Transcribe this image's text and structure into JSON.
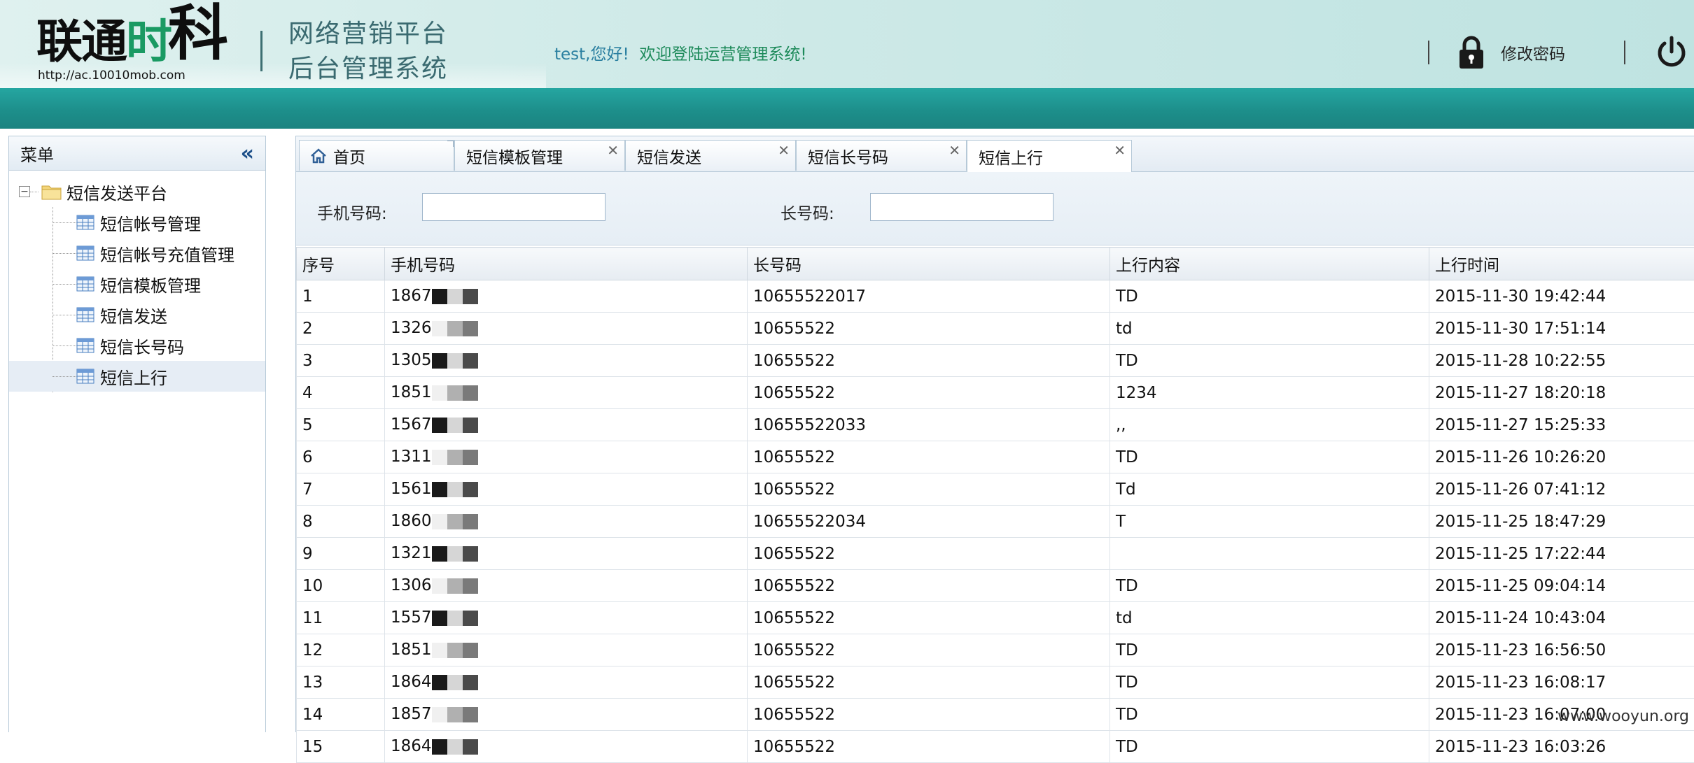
{
  "header": {
    "logo_text_a": "联通",
    "logo_text_b": "时",
    "logo_text_c": "科",
    "logo_url": "http://ac.10010mob.com",
    "platform_line1": "网络营销平台",
    "platform_line2": "后台管理系统",
    "greeting": "test,您好!",
    "welcome": "欢迎登陆运营管理系统!",
    "change_password": "修改密码",
    "colors": {
      "band": "#1d8f8b",
      "welcome_text": "#1d8a5a"
    }
  },
  "sidebar": {
    "title": "菜单",
    "collapse_icon": "double-chevron-left-icon",
    "root": {
      "toggle": "−",
      "label": "短信发送平台",
      "icon": "folder-icon"
    },
    "items": [
      {
        "label": "短信帐号管理",
        "icon": "table-icon",
        "selected": false
      },
      {
        "label": "短信帐号充值管理",
        "icon": "table-icon",
        "selected": false
      },
      {
        "label": "短信模板管理",
        "icon": "table-icon",
        "selected": false
      },
      {
        "label": "短信发送",
        "icon": "table-icon",
        "selected": false
      },
      {
        "label": "短信长号码",
        "icon": "table-icon",
        "selected": false
      },
      {
        "label": "短信上行",
        "icon": "table-icon",
        "selected": true
      }
    ]
  },
  "tabs": [
    {
      "label": "首页",
      "icon": "home-icon",
      "closable": false,
      "active": false
    },
    {
      "label": "短信模板管理",
      "closable": true,
      "active": false
    },
    {
      "label": "短信发送",
      "closable": true,
      "active": false
    },
    {
      "label": "短信长号码",
      "closable": true,
      "active": false
    },
    {
      "label": "短信上行",
      "closable": true,
      "active": true
    }
  ],
  "search": {
    "phone_label": "手机号码:",
    "phone_value": "",
    "long_code_label": "长号码:",
    "long_code_value": ""
  },
  "table": {
    "columns": [
      "序号",
      "手机号码",
      "长号码",
      "上行内容",
      "上行时间"
    ],
    "rows": [
      {
        "no": "1",
        "phone": "1867",
        "long_code": "10655522017",
        "content": "TD",
        "time": "2015-11-30 19:42:44"
      },
      {
        "no": "2",
        "phone": "1326",
        "long_code": "10655522",
        "content": "td",
        "time": "2015-11-30 17:51:14"
      },
      {
        "no": "3",
        "phone": "1305",
        "long_code": "10655522",
        "content": "TD",
        "time": "2015-11-28 10:22:55"
      },
      {
        "no": "4",
        "phone": "1851",
        "long_code": "10655522",
        "content": "1234",
        "time": "2015-11-27 18:20:18"
      },
      {
        "no": "5",
        "phone": "1567",
        "long_code": "10655522033",
        "content": ",,",
        "time": "2015-11-27 15:25:33"
      },
      {
        "no": "6",
        "phone": "1311",
        "long_code": "10655522",
        "content": "TD",
        "time": "2015-11-26 10:26:20"
      },
      {
        "no": "7",
        "phone": "1561",
        "long_code": "10655522",
        "content": "Td",
        "time": "2015-11-26 07:41:12"
      },
      {
        "no": "8",
        "phone": "1860",
        "long_code": "10655522034",
        "content": "T",
        "time": "2015-11-25 18:47:29"
      },
      {
        "no": "9",
        "phone": "1321",
        "long_code": "10655522",
        "content": "",
        "time": "2015-11-25 17:22:44"
      },
      {
        "no": "10",
        "phone": "1306",
        "long_code": "10655522",
        "content": "TD",
        "time": "2015-11-25 09:04:14"
      },
      {
        "no": "11",
        "phone": "1557",
        "long_code": "10655522",
        "content": "td",
        "time": "2015-11-24 10:43:04"
      },
      {
        "no": "12",
        "phone": "1851",
        "long_code": "10655522",
        "content": "TD",
        "time": "2015-11-23 16:56:50"
      },
      {
        "no": "13",
        "phone": "1864",
        "long_code": "10655522",
        "content": "TD",
        "time": "2015-11-23 16:08:17"
      },
      {
        "no": "14",
        "phone": "1857",
        "long_code": "10655522",
        "content": "TD",
        "time": "2015-11-23 16:07:00"
      },
      {
        "no": "15",
        "phone": "1864",
        "long_code": "10655522",
        "content": "TD",
        "time": "2015-11-23 16:03:26"
      }
    ]
  },
  "watermark": "www.wooyun.org"
}
